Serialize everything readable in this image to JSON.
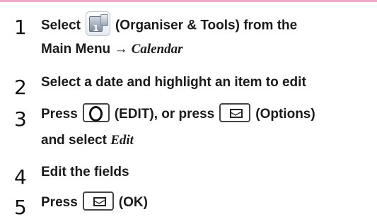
{
  "colors": {
    "accent_strip": "#f1a9c8"
  },
  "steps": [
    {
      "number": "1",
      "line1": {
        "pre": "Select",
        "icon": "organiser-tools-app-icon",
        "icon_digit": "1",
        "post": "(Organiser & Tools) from the"
      },
      "line2": {
        "pre": "Main Menu",
        "arrow": "→",
        "italic": "Calendar"
      }
    },
    {
      "number": "2",
      "text": "Select a date and highlight an item to edit"
    },
    {
      "number": "3",
      "line1": {
        "pre": "Press",
        "key1_icon": "center-key-icon",
        "key1_text": "(EDIT), or press",
        "key2_icon": "mail-key-icon",
        "key2_text": "(Options)"
      },
      "line2": {
        "pre": "and select",
        "italic": "Edit"
      }
    },
    {
      "number": "4",
      "text": "Edit the fields"
    },
    {
      "number": "5",
      "pre": "Press",
      "key_icon": "mail-key-icon",
      "post": "(OK)"
    }
  ]
}
